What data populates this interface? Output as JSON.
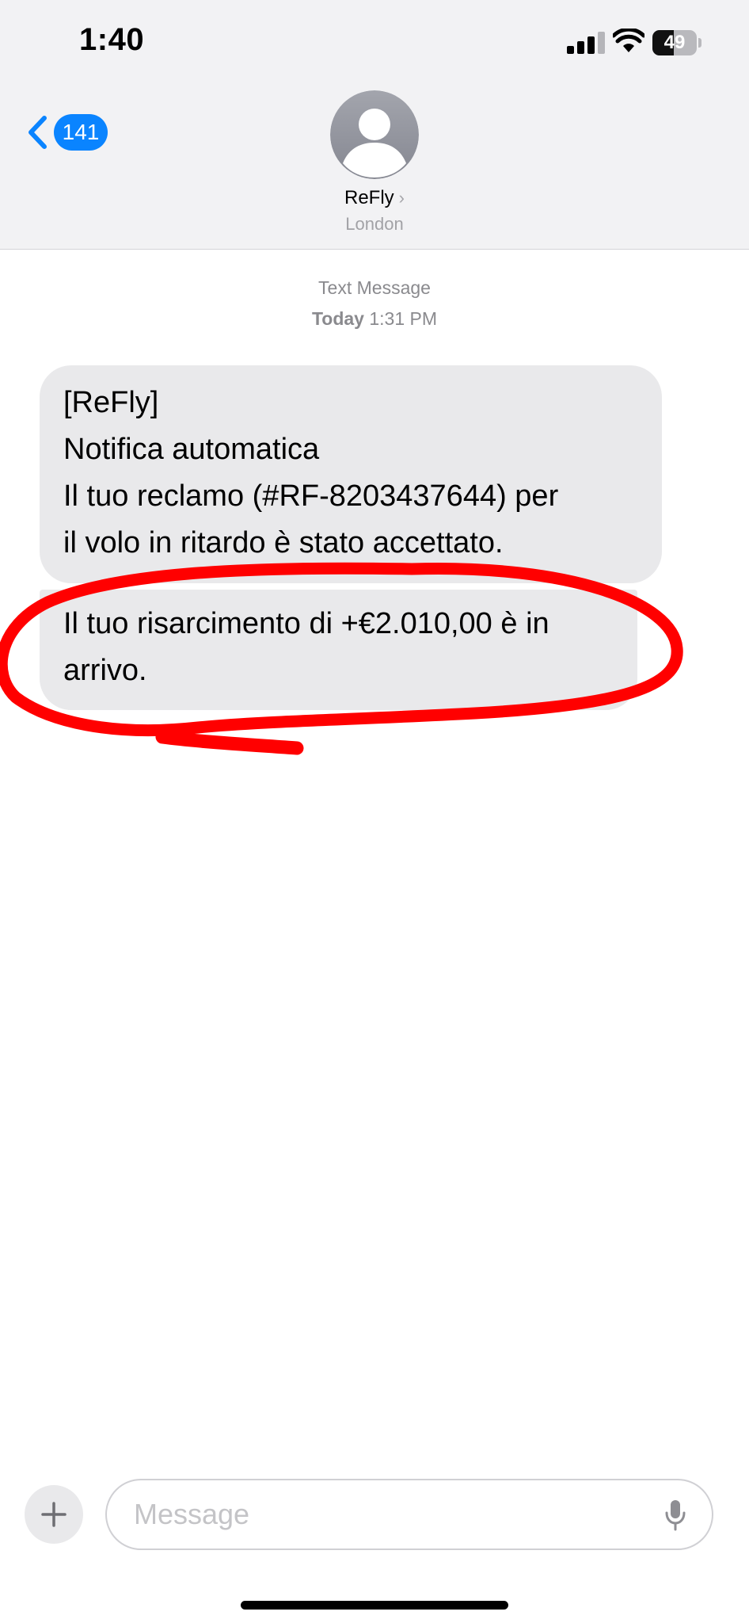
{
  "status_bar": {
    "time": "1:40",
    "battery_level": "49",
    "signal_icon": "cellular-signal-icon",
    "wifi_icon": "wifi-icon",
    "battery_icon": "battery-icon"
  },
  "nav": {
    "back_icon": "chevron-left-icon",
    "unread_count": "141",
    "contact_name": "ReFly",
    "contact_chevron": "›",
    "contact_location": "London",
    "avatar_icon": "person-avatar-icon"
  },
  "conversation": {
    "timestamp_type": "Text Message",
    "timestamp_day": "Today",
    "timestamp_time": "1:31 PM",
    "messages": [
      {
        "text": "[ReFly]\nNotifica automatica\nIl tuo reclamo (#RF-8203437644) per\nil volo in ritardo è stato accettato."
      },
      {
        "text": "Il tuo risarcimento di +€2.010,00 è in\narrivo."
      }
    ],
    "annotation_color": "#ff0000"
  },
  "composer": {
    "add_icon": "plus-icon",
    "placeholder": "Message",
    "value": "",
    "mic_icon": "microphone-icon"
  },
  "colors": {
    "accent": "#0a84ff",
    "bubble": "#e9e9eb",
    "header_bg": "#f2f2f4"
  }
}
